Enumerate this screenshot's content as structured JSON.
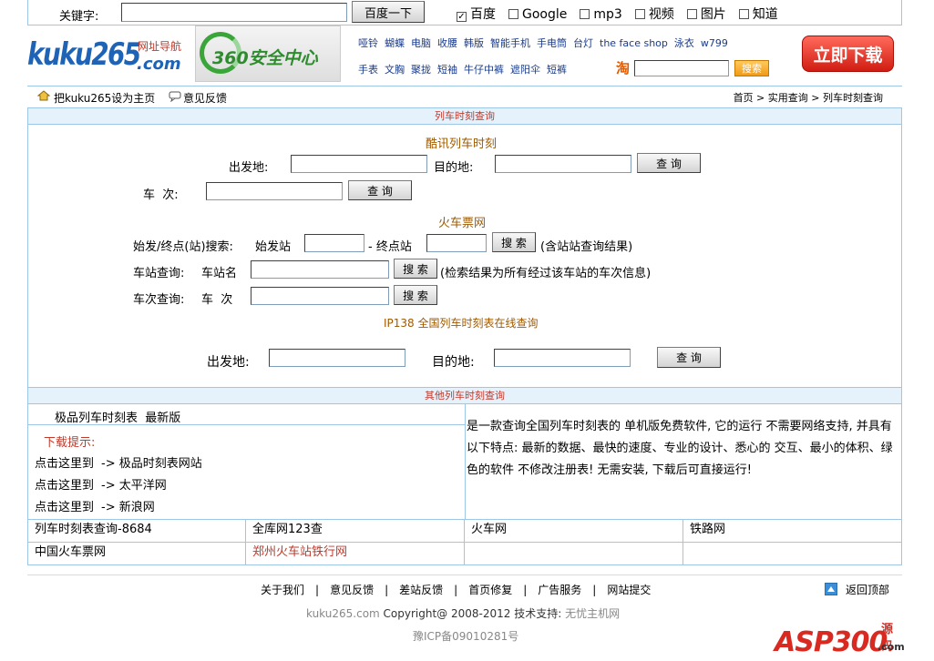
{
  "topbar": {
    "keyword_label": "关键字:",
    "search_button": "百度一下",
    "options": [
      {
        "label": "百度",
        "checked": true
      },
      {
        "label": "Google",
        "checked": false
      },
      {
        "label": "mp3",
        "checked": false
      },
      {
        "label": "视频",
        "checked": false
      },
      {
        "label": "图片",
        "checked": false
      },
      {
        "label": "知道",
        "checked": false
      }
    ]
  },
  "header": {
    "logo_text": "kuku265",
    "logo_suffix": ".com",
    "logo_tag": "网址导航",
    "ad_text": "360安全中心",
    "hot_row1": [
      "哑铃",
      "蝴蝶",
      "电脑",
      "收腰",
      "韩版",
      "智能手机",
      "手电筒",
      "台灯",
      "the face shop",
      "泳衣",
      "w799"
    ],
    "hot_row2": [
      "手表",
      "文胸",
      "聚拢",
      "短袖",
      "牛仔中裤",
      "遮阳伞",
      "短裤"
    ],
    "taobao_icon": "淘",
    "taobao_button": "搜索",
    "download_button": "立即下载"
  },
  "nav": {
    "set_home": "把kuku265设为主页",
    "feedback": "意见反馈",
    "crumb_home": "首页",
    "crumb_mid": "实用查询",
    "crumb_current": "列车时刻查询"
  },
  "section1": {
    "title": "列车时刻查询",
    "kuxun": {
      "title": "酷讯列车时刻",
      "from_label": "出发地:",
      "to_label": "目的地:",
      "query_button": "查 询",
      "train_label": "车  次:",
      "query_button2": "查 询"
    },
    "huoche": {
      "title": "火车票网",
      "row1_label": "始发/终点(站)搜索:",
      "start_label": "始发站",
      "end_label": "- 终点站",
      "search_button": "搜 索",
      "row1_note": "(含站站查询结果)",
      "row2_label": "车站查询:",
      "station_label": "车站名",
      "row2_note": "(检索结果为所有经过该车站的车次信息)",
      "row3_label": "车次查询:",
      "train_label": "车  次"
    },
    "ip138": {
      "title": "IP138 全国列车时刻表在线查询",
      "from_label": "出发地:",
      "to_label": "目的地:",
      "query_button": "查 询"
    }
  },
  "section2": {
    "title": "其他列车时刻查询",
    "product_title": "极品列车时刻表  最新版",
    "download_tip": "下载提示:",
    "links": [
      {
        "prefix": "点击这里到",
        "target": "-> 极品时刻表网站"
      },
      {
        "prefix": "点击这里到",
        "target": "-> 太平洋网"
      },
      {
        "prefix": "点击这里到",
        "target": "-> 新浪网"
      }
    ],
    "description": "是一款查询全国列车时刻表的 单机版免费软件, 它的运行 不需要网络支持, 并具有以下特点: 最新的数据、最快的速度、专业的设计、悉心的 交互、最小的体积、绿色的软件 不修改注册表! 无需安装, 下载后可直接运行!",
    "table": [
      [
        "列车时刻表查询-8684",
        "全库网123查",
        "火车网",
        "铁路网"
      ],
      [
        "中国火车票网",
        "郑州火车站铁行网",
        "",
        ""
      ]
    ]
  },
  "footer": {
    "links": [
      "关于我们",
      "意见反馈",
      "差站反馈",
      "首页修复",
      "广告服务",
      "网站提交"
    ],
    "back_top": "返回顶部",
    "copyright_site": "kuku265.com",
    "copyright_text": "Copyright@ 2008-2012 技术支持:",
    "copyright_support": "无忧主机网",
    "icp": "豫ICP备09010281号",
    "watermark": "ASP300",
    "watermark_tag": "源码",
    "watermark_domain": ".com"
  },
  "colors": {
    "brand_blue": "#1e63b6",
    "section_bg": "#e6f2fb",
    "border_blue": "#9ec6e6",
    "title_orange": "#a05a00",
    "red": "#c0392b"
  }
}
